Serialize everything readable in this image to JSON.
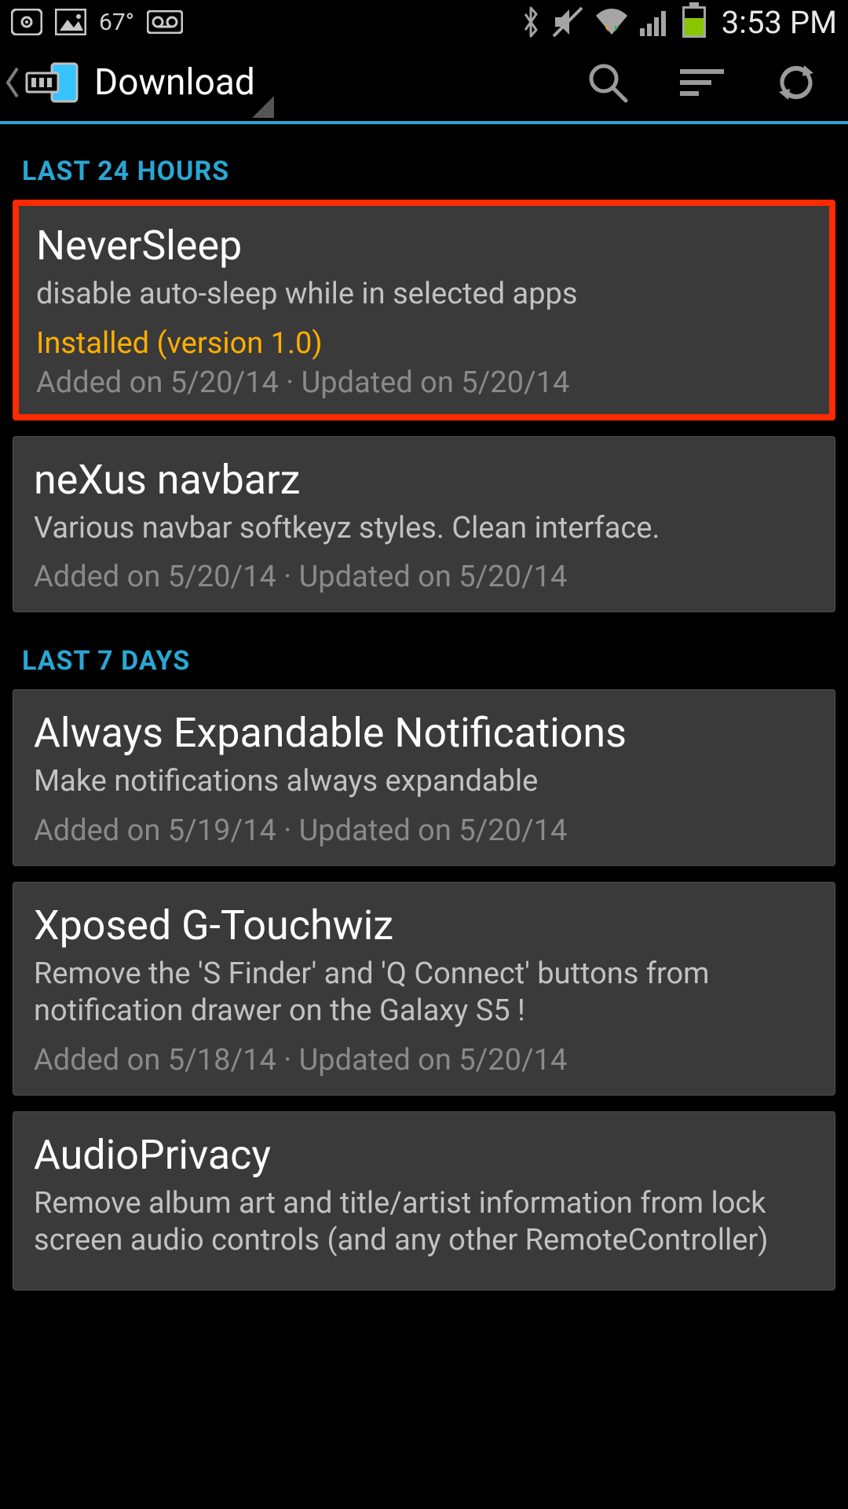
{
  "status": {
    "temp": "67°",
    "time": "3:53 PM"
  },
  "actionbar": {
    "title": "Download"
  },
  "sections": [
    {
      "header": "LAST 24 HOURS",
      "items": [
        {
          "title": "NeverSleep",
          "desc": "disable auto-sleep while in selected apps",
          "status": "Installed (version 1.0)",
          "meta": "Added on 5/20/14 · Updated on 5/20/14",
          "highlight": true
        },
        {
          "title": "neXus navbarz",
          "desc": "Various navbar softkeyz styles. Clean interface.",
          "status": "",
          "meta": "Added on 5/20/14 · Updated on 5/20/14",
          "highlight": false
        }
      ]
    },
    {
      "header": "LAST 7 DAYS",
      "items": [
        {
          "title": "Always Expandable Notifications",
          "desc": "Make notifications always expandable",
          "status": "",
          "meta": "Added on 5/19/14 · Updated on 5/20/14",
          "highlight": false
        },
        {
          "title": "Xposed G-Touchwiz",
          "desc": "Remove the 'S Finder' and 'Q Connect' buttons from notification drawer on the Galaxy S5 !",
          "status": "",
          "meta": "Added on 5/18/14 · Updated on 5/20/14",
          "highlight": false
        },
        {
          "title": "AudioPrivacy",
          "desc": "Remove album art and title/artist information from lock screen audio controls (and any other RemoteController)",
          "status": "",
          "meta": "",
          "highlight": false
        }
      ]
    }
  ]
}
